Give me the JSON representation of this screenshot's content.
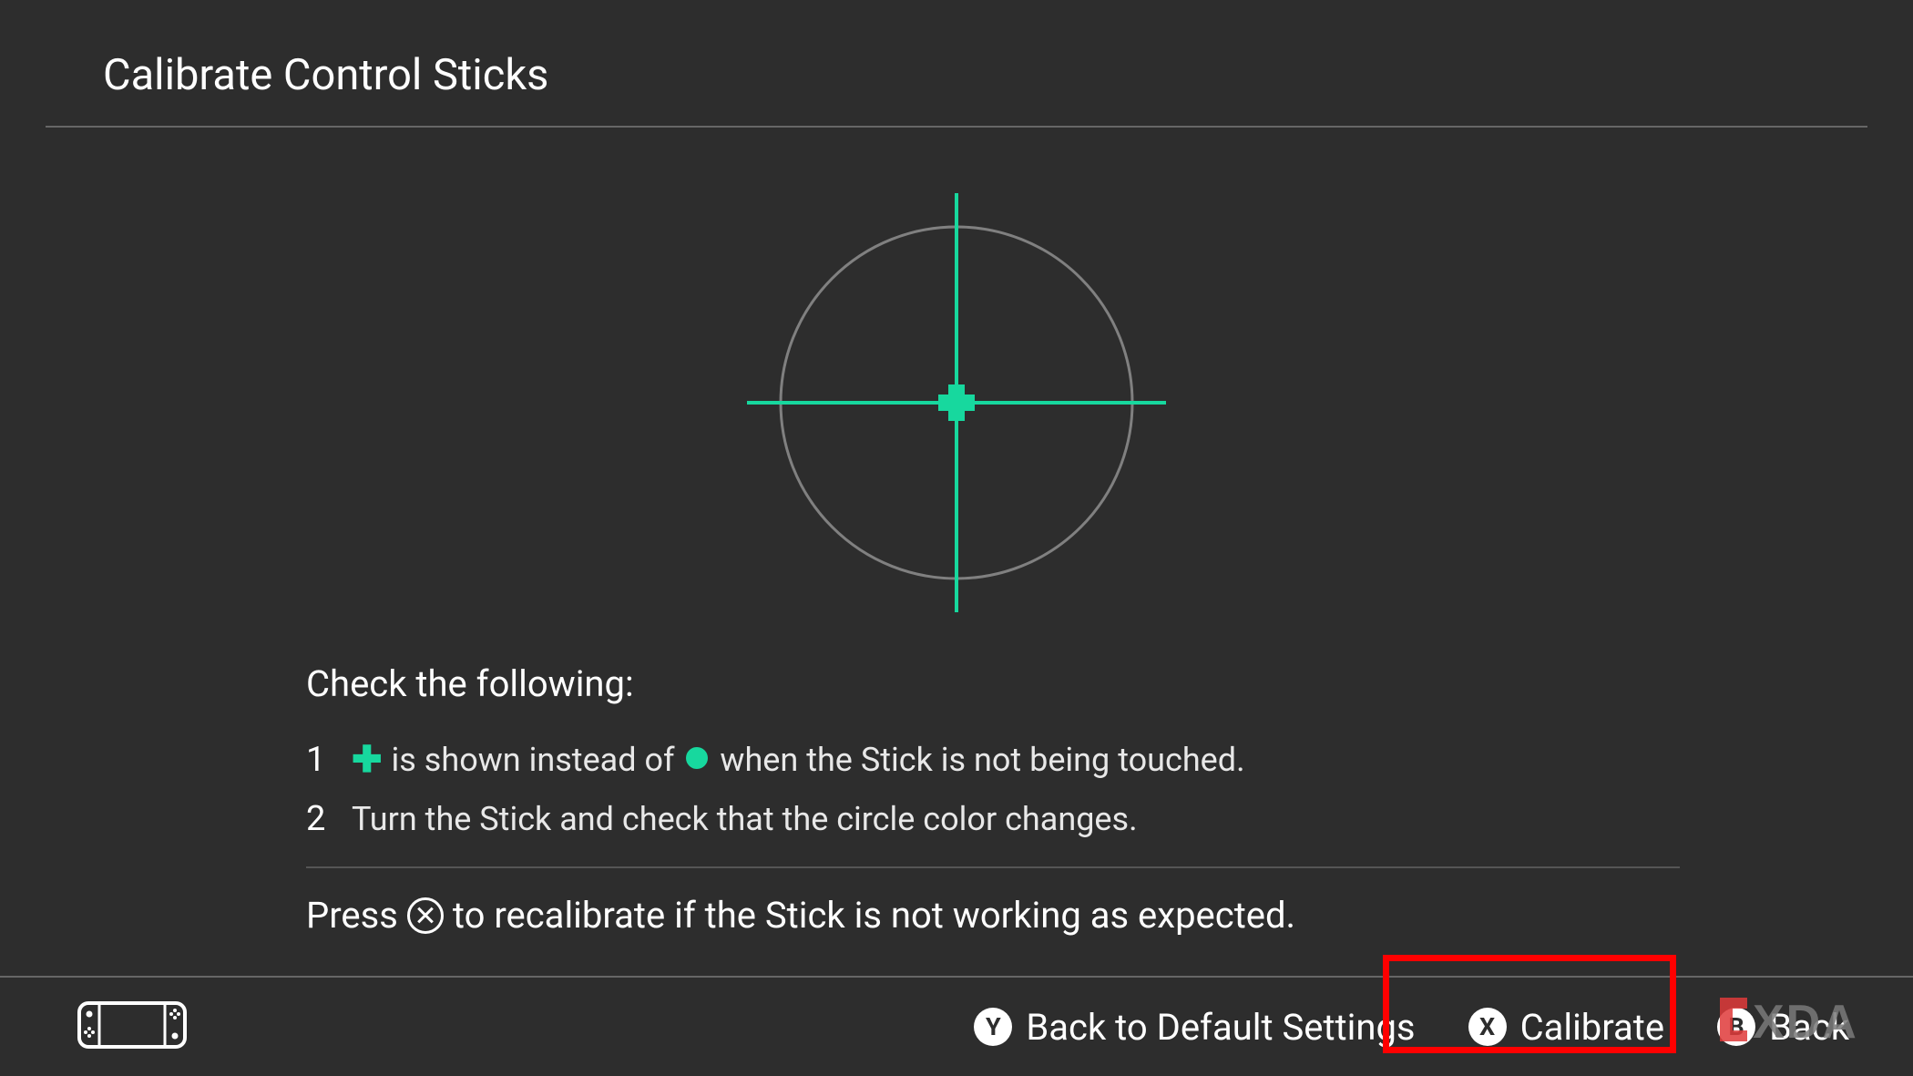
{
  "header": {
    "title": "Calibrate Control Sticks"
  },
  "instructions": {
    "heading": "Check the following:",
    "item1_num": "1",
    "item1_part1": "is shown instead of",
    "item1_part2": "when the Stick is not being touched.",
    "item2_num": "2",
    "item2_text": "Turn the Stick and check that the circle color changes.",
    "recalibrate_part1": "Press",
    "recalibrate_part2": "to recalibrate if the Stick is not working as expected."
  },
  "footer": {
    "y_label": "Back to Default Settings",
    "x_label": "Calibrate",
    "b_label": "Back"
  },
  "colors": {
    "accent": "#17d89e",
    "bg": "#2d2d2d",
    "watermark_red": "#e03a3a"
  },
  "watermark": {
    "text": "XDA"
  }
}
